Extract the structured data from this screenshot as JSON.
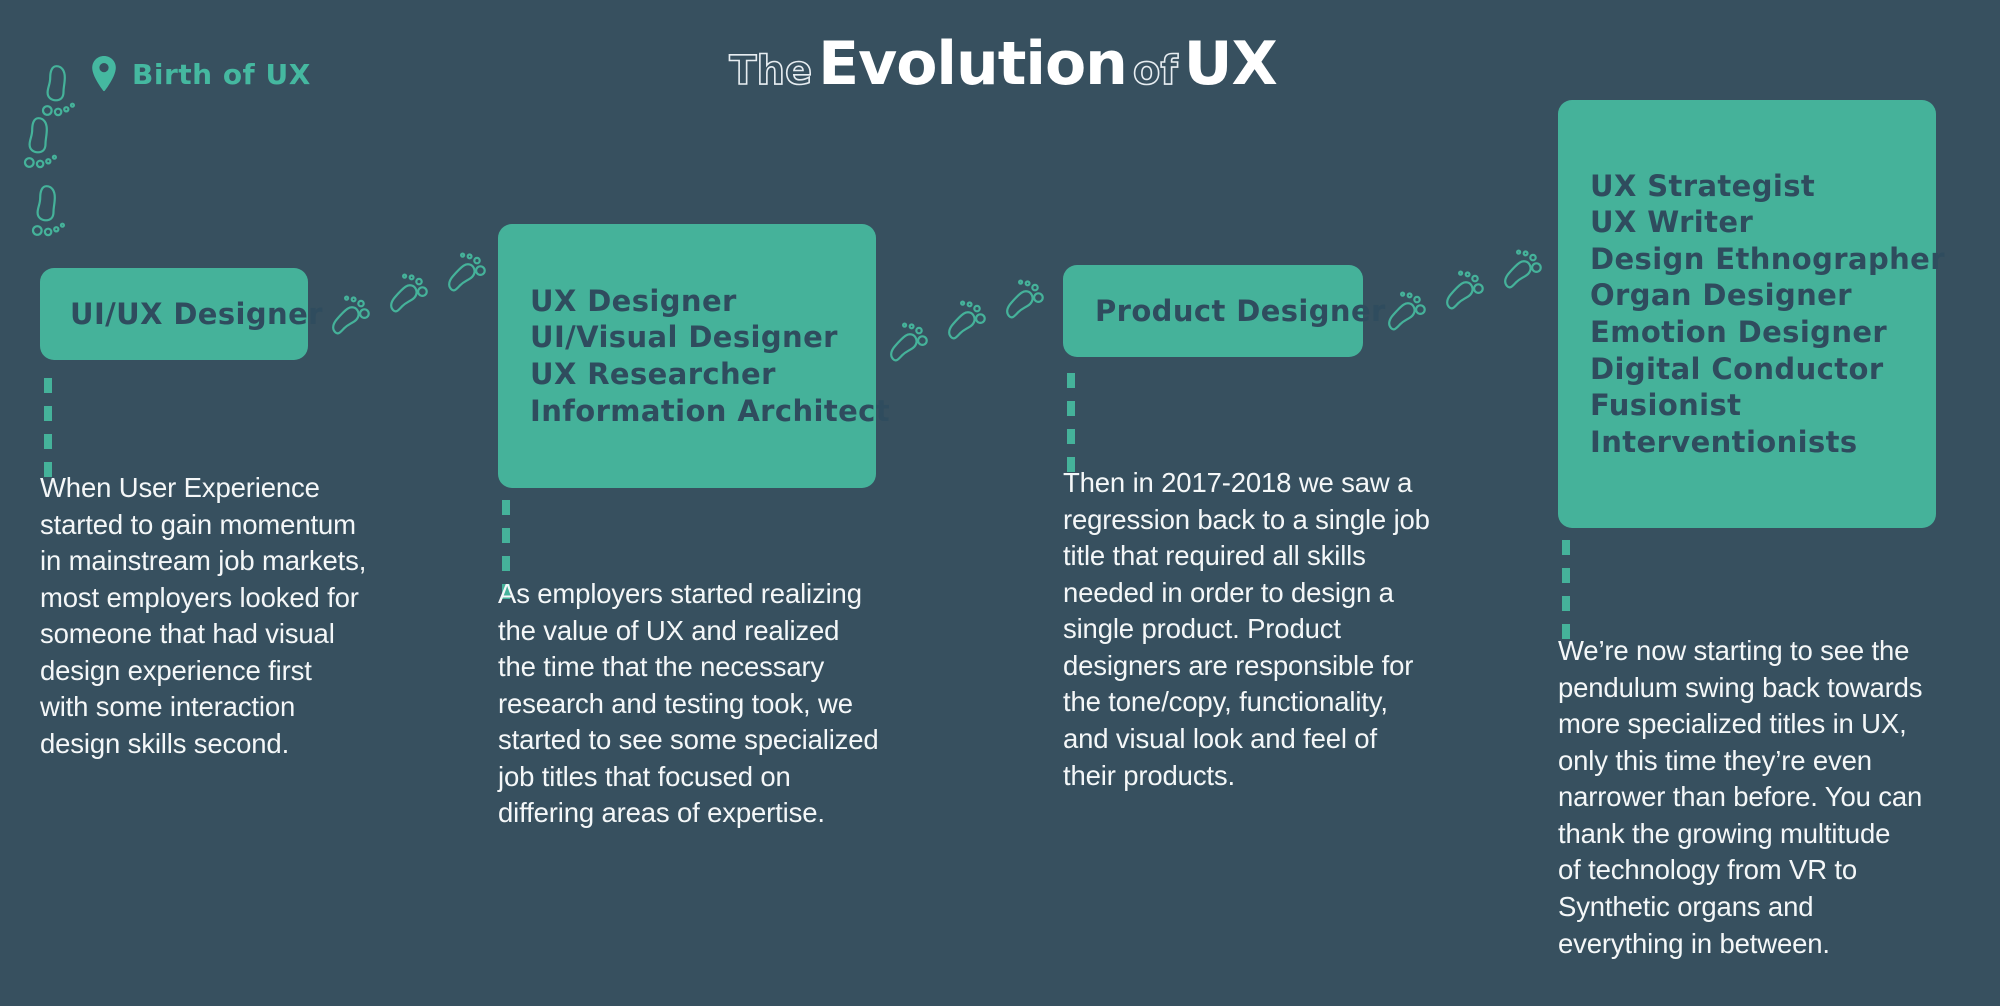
{
  "page": {
    "background_color": "#37505f",
    "accent_color": "#45b29a",
    "card_text_color": "#2f4c5e",
    "body_text_color": "#f4f7f8"
  },
  "header": {
    "title_part1": "The",
    "title_part2": "Evolution",
    "title_part3": "of",
    "title_part4": "UX",
    "pin_icon": "map-pin-icon",
    "birth_label": "Birth of UX"
  },
  "timeline": {
    "stages": [
      {
        "id": "ui-ux-designer",
        "titles": [
          "UI/UX Designer"
        ],
        "body": "When User Experience\nstarted to gain momentum\nin mainstream job markets,\nmost employers looked for\nsomeone that had visual\ndesign experience first\nwith some interaction\ndesign skills second."
      },
      {
        "id": "specialized-titles",
        "titles": [
          "UX Designer",
          "UI/Visual Designer",
          "UX Researcher",
          "Information Architect"
        ],
        "body": "As employers started realizing\nthe value of UX and realized\nthe time that the necessary\nresearch and testing took, we\nstarted to see some specialized\njob titles that focused on\ndiffering areas of expertise."
      },
      {
        "id": "product-designer",
        "titles": [
          "Product Designer"
        ],
        "body": "Then in 2017-2018 we saw a\nregression back to a single job\ntitle that required all skills\nneeded in order to design a\nsingle product. Product\ndesigners are responsible for\nthe tone/copy, functionality,\nand  visual look and feel of\ntheir products."
      },
      {
        "id": "future-titles",
        "titles": [
          "UX Strategist",
          "UX Writer",
          "Design Ethnographer",
          "Organ Designer",
          "Emotion Designer",
          "Digital Conductor",
          "Fusionist",
          "Interventionists"
        ],
        "body": "We’re now starting to see the\npendulum swing back towards\nmore specialized titles in UX,\nonly this time they’re even\nnarrower than before. You can\nthank the growing multitude\nof technology from VR to\nSynthetic organs and\neverything in between."
      }
    ]
  },
  "decorations": {
    "footprint_icon": "footprint-icon",
    "footprint_count_vertical": 3,
    "footprint_groups_horizontal": 3
  }
}
